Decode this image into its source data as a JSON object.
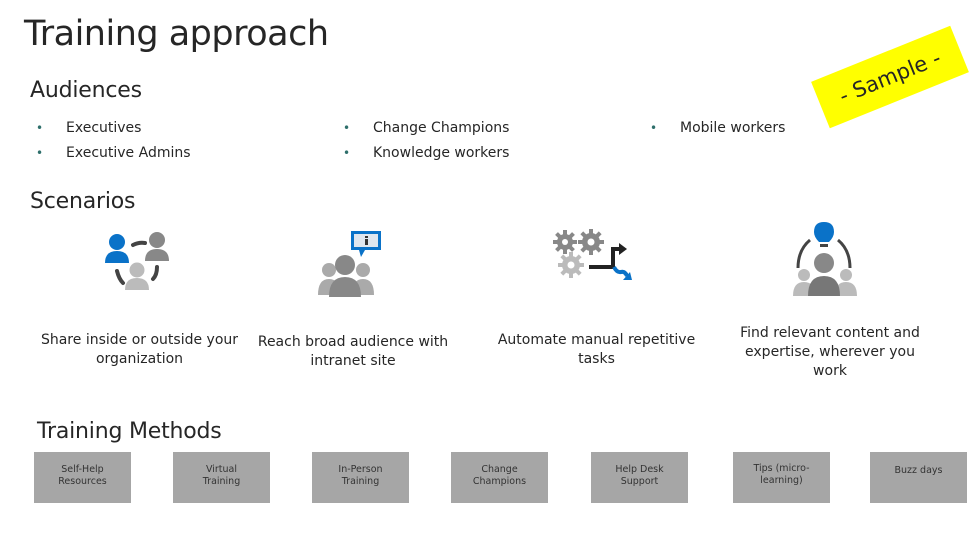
{
  "title": "Training approach",
  "watermark": "- Sample -",
  "audiences": {
    "heading": "Audiences",
    "columns": [
      [
        "Executives",
        "Executive Admins"
      ],
      [
        "Change Champions",
        "Knowledge workers"
      ],
      [
        "Mobile workers"
      ]
    ]
  },
  "scenarios": {
    "heading": "Scenarios",
    "items": [
      {
        "icon": "people-sharing-icon",
        "text": "Share inside or outside your organization"
      },
      {
        "icon": "intranet-info-icon",
        "text": "Reach broad audience with intranet site"
      },
      {
        "icon": "gears-automation-icon",
        "text": "Automate manual repetitive tasks"
      },
      {
        "icon": "lightbulb-people-icon",
        "text": "Find relevant content and expertise, wherever you work"
      }
    ]
  },
  "training_methods": {
    "heading": "Training Methods",
    "items": [
      "Self-Help Resources",
      "Virtual Training",
      "In-Person Training",
      "Change Champions",
      "Help Desk Support",
      "Tips (micro-learning)",
      "Buzz days"
    ]
  },
  "colors": {
    "accent_blue": "#0a72c8",
    "watermark_yellow": "#ffff00",
    "method_box": "#a6a6a6"
  }
}
